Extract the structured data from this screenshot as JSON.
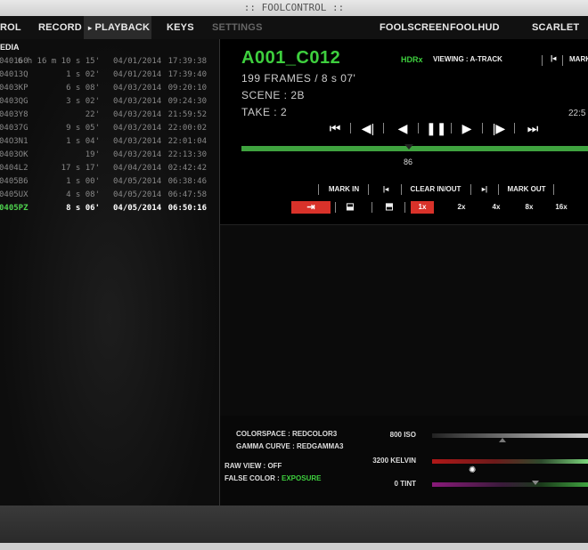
{
  "window_title": ":: FOOLCONTROL ::",
  "nav": {
    "control": "ROL",
    "record": "RECORD",
    "playback": "PLAYBACK",
    "playback_icon": "▸",
    "keys": "KEYS",
    "settings": "SETTINGS",
    "foolscreen": "FOOLSCREEN",
    "foolhud": "FOOLHUD",
    "camera": "SCARLET"
  },
  "media": {
    "header": "EDIA",
    "rows": [
      {
        "name": "040160",
        "dur": "6 h 16 m 10 s 15'",
        "date": "04/01/2014",
        "time": "17:39:38"
      },
      {
        "name": "04013Q",
        "dur": "1 s 02'",
        "date": "04/01/2014",
        "time": "17:39:40"
      },
      {
        "name": "0403KP",
        "dur": "6 s 08'",
        "date": "04/03/2014",
        "time": "09:20:10"
      },
      {
        "name": "0403QG",
        "dur": "3 s 02'",
        "date": "04/03/2014",
        "time": "09:24:30"
      },
      {
        "name": "0403Y8",
        "dur": "22'",
        "date": "04/03/2014",
        "time": "21:59:52"
      },
      {
        "name": "04037G",
        "dur": "9 s 05'",
        "date": "04/03/2014",
        "time": "22:00:02"
      },
      {
        "name": "04O3N1",
        "dur": "1 s 04'",
        "date": "04/03/2014",
        "time": "22:01:04"
      },
      {
        "name": "0403OK",
        "dur": "19'",
        "date": "04/03/2014",
        "time": "22:13:30"
      },
      {
        "name": "0404L2",
        "dur": "17 s 17'",
        "date": "04/04/2014",
        "time": "02:42:42"
      },
      {
        "name": "0405B6",
        "dur": "1 s 00'",
        "date": "04/05/2014",
        "time": "06:38:46"
      },
      {
        "name": "0405UX",
        "dur": "4 s 08'",
        "date": "04/05/2014",
        "time": "06:47:58"
      },
      {
        "name": "0405PZ",
        "dur": "8 s 06'",
        "date": "04/05/2014",
        "time": "06:50:16"
      }
    ],
    "selected_index": 11
  },
  "clip": {
    "title": "A001_C012",
    "frames": "199 FRAMES / 8 s 07'",
    "scene": "SCENE : 2B",
    "take": "TAKE : 2",
    "hdrx": "HDRx",
    "viewing": "VIEWING : A-TRACK",
    "mark_short": "MARK",
    "timecode": "22:5",
    "current_frame": "86",
    "progress_fraction": 0.43
  },
  "transport": [
    "⏮",
    "◀|",
    "◀",
    "❚❚",
    "▶",
    "|▶",
    "⏭"
  ],
  "marks": {
    "mark_in": "MARK IN",
    "clear": "CLEAR IN/OUT",
    "mark_out": "MARK OUT",
    "prev_icon": "|◂",
    "next_icon": "▸|"
  },
  "speeds": {
    "loop_icon": "⇥",
    "seg_icon": "⬓",
    "seg2_icon": "⬒",
    "values": [
      "1x",
      "2x",
      "4x",
      "8x",
      "16x"
    ],
    "active": "1x"
  },
  "looks": {
    "colorspace_label": "COLORSPACE : ",
    "colorspace_value": "REDCOLOR3",
    "gamma_label": "GAMMA CURVE : ",
    "gamma_value": "REDGAMMA3",
    "raw_view": "RAW VIEW : OFF",
    "false_color_label": "FALSE COLOR : ",
    "false_color_value": "EXPOSURE",
    "iso": "800 ISO",
    "kelvin": "3200 KELVIN",
    "tint": "0 TINT"
  },
  "colors": {
    "accent_green": "#3ecf3e",
    "active_red": "#d9322a"
  }
}
